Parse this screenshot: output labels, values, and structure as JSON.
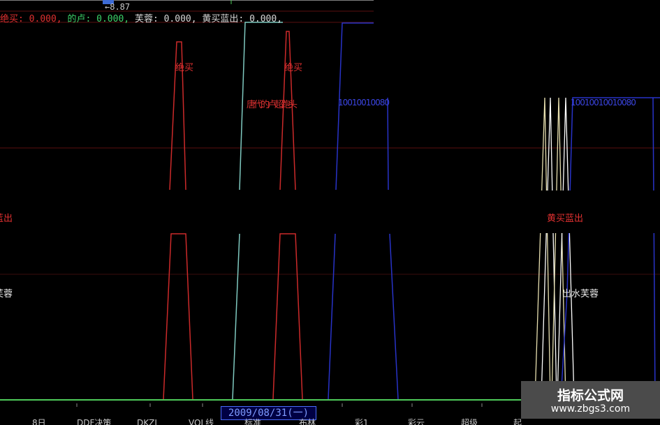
{
  "top_ref": "←8.87",
  "header": {
    "items": [
      {
        "label": "绝买",
        "value": ": 0.000, ",
        "color": "#e03030"
      },
      {
        "label": "的卢",
        "value": ": 0.000, ",
        "color": "#3cd46a"
      },
      {
        "label": "芙蓉",
        "value": ": 0.000, ",
        "color": "#d8d8d8"
      },
      {
        "label": "黄买蓝出",
        "value": ": 0.000,",
        "color": "#d8d8d8"
      }
    ]
  },
  "annotations": {
    "jue_mai_left": "绝买",
    "jue_mai_right": "绝买",
    "mixed_label": "唐代的卢超跑头",
    "blue_nums_left": "10010010080",
    "blue_nums_right": "10010010010080",
    "huang_mai_lan_chu_right": "黄买蓝出",
    "lan_chu_left": "蓝出",
    "fu_rong_left": "芙蓉",
    "chu_shui_fu_rong": "出水芙蓉"
  },
  "date_label": "2009/08/31(一)",
  "tabs": [
    "8日",
    "DDF决策",
    "DKZJ",
    "VOL线",
    "标准",
    "布林",
    "彩1",
    "彩云",
    "超级",
    "起"
  ],
  "watermark": {
    "title": "指标公式网",
    "url": "www.zbgs3.com"
  },
  "colors": {
    "red": "#cc2a2a",
    "cyan": "#7fc9c0",
    "blue": "#2833c8",
    "white_yellow": "#e8e0b0",
    "dark_red_grid": "#5a1010",
    "axis_green": "#4ecb5a",
    "date_blue": "#4a6cff"
  }
}
